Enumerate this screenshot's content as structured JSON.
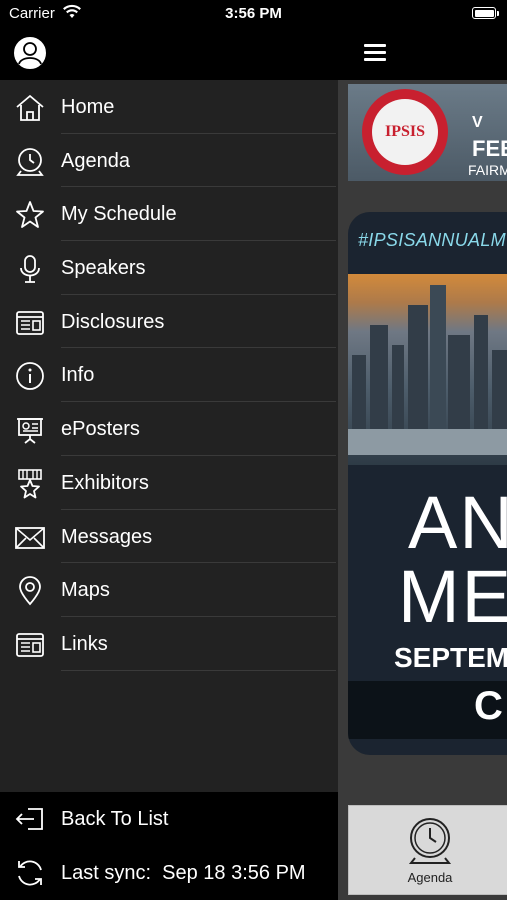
{
  "status_bar": {
    "carrier": "Carrier",
    "time": "3:56 PM"
  },
  "drawer": {
    "menu": [
      {
        "label": "Home",
        "icon": "home-icon"
      },
      {
        "label": "Agenda",
        "icon": "clock-icon"
      },
      {
        "label": "My Schedule",
        "icon": "star-icon"
      },
      {
        "label": "Speakers",
        "icon": "microphone-icon"
      },
      {
        "label": "Disclosures",
        "icon": "window-list-icon"
      },
      {
        "label": "Info",
        "icon": "info-icon"
      },
      {
        "label": "ePosters",
        "icon": "easel-icon"
      },
      {
        "label": "Exhibitors",
        "icon": "award-icon"
      },
      {
        "label": "Messages",
        "icon": "envelope-icon"
      },
      {
        "label": "Maps",
        "icon": "map-pin-icon"
      },
      {
        "label": "Links",
        "icon": "window-list-icon"
      }
    ],
    "footer": {
      "back_label": "Back To List",
      "sync_label": "Last sync:  Sep 18 3:56 PM"
    }
  },
  "main": {
    "banner": {
      "logo_text": "IPSIS",
      "line1": "V",
      "line2": "FEE",
      "line3": "FAIRM"
    },
    "promo": {
      "hashtag": "#IPSISANNUALM",
      "big_line1": "AN",
      "big_line2": "ME",
      "date_line": "SEPTEM",
      "bottom_line": "C"
    },
    "tab": {
      "label": "Agenda"
    }
  },
  "colors": {
    "drawer_bg": "#222222",
    "header_bg": "#000000",
    "brand_red": "#c8202f",
    "hashtag": "#8ad9ea"
  }
}
